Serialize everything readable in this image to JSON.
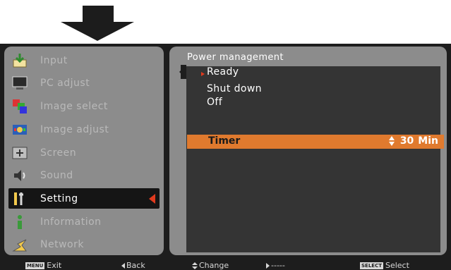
{
  "arrow": {
    "icon": "down-arrow-icon",
    "color": "#1c1c1c"
  },
  "left_menu": {
    "items": [
      {
        "label": "Input",
        "icon": "input-icon",
        "active": false
      },
      {
        "label": "PC adjust",
        "icon": "pc-adjust-icon",
        "active": false
      },
      {
        "label": "Image select",
        "icon": "image-select-icon",
        "active": false
      },
      {
        "label": "Image adjust",
        "icon": "image-adjust-icon",
        "active": false
      },
      {
        "label": "Screen",
        "icon": "screen-icon",
        "active": false
      },
      {
        "label": "Sound",
        "icon": "sound-icon",
        "active": false
      },
      {
        "label": "Setting",
        "icon": "setting-icon",
        "active": true
      },
      {
        "label": "Information",
        "icon": "information-icon",
        "active": false
      },
      {
        "label": "Network",
        "icon": "network-icon",
        "active": false
      }
    ]
  },
  "right_panel": {
    "title": "Power management",
    "options": [
      {
        "label": "Ready",
        "selected": true
      },
      {
        "label": "Shut down",
        "selected": false
      },
      {
        "label": "Off",
        "selected": false
      }
    ],
    "timer": {
      "label": "Timer",
      "value": "30",
      "unit": "Min"
    }
  },
  "bottom_bar": {
    "exit_key": "MENU",
    "exit": "Exit",
    "back": "Back",
    "change": "Change",
    "next": "-----",
    "select_key": "SELECT",
    "select": "Select"
  },
  "colors": {
    "panel_gray": "#8c8c8c",
    "inner_dark": "#343434",
    "highlight_orange": "#e07a2e",
    "accent_red": "#e03a1e",
    "background": "#1d1d1d"
  }
}
